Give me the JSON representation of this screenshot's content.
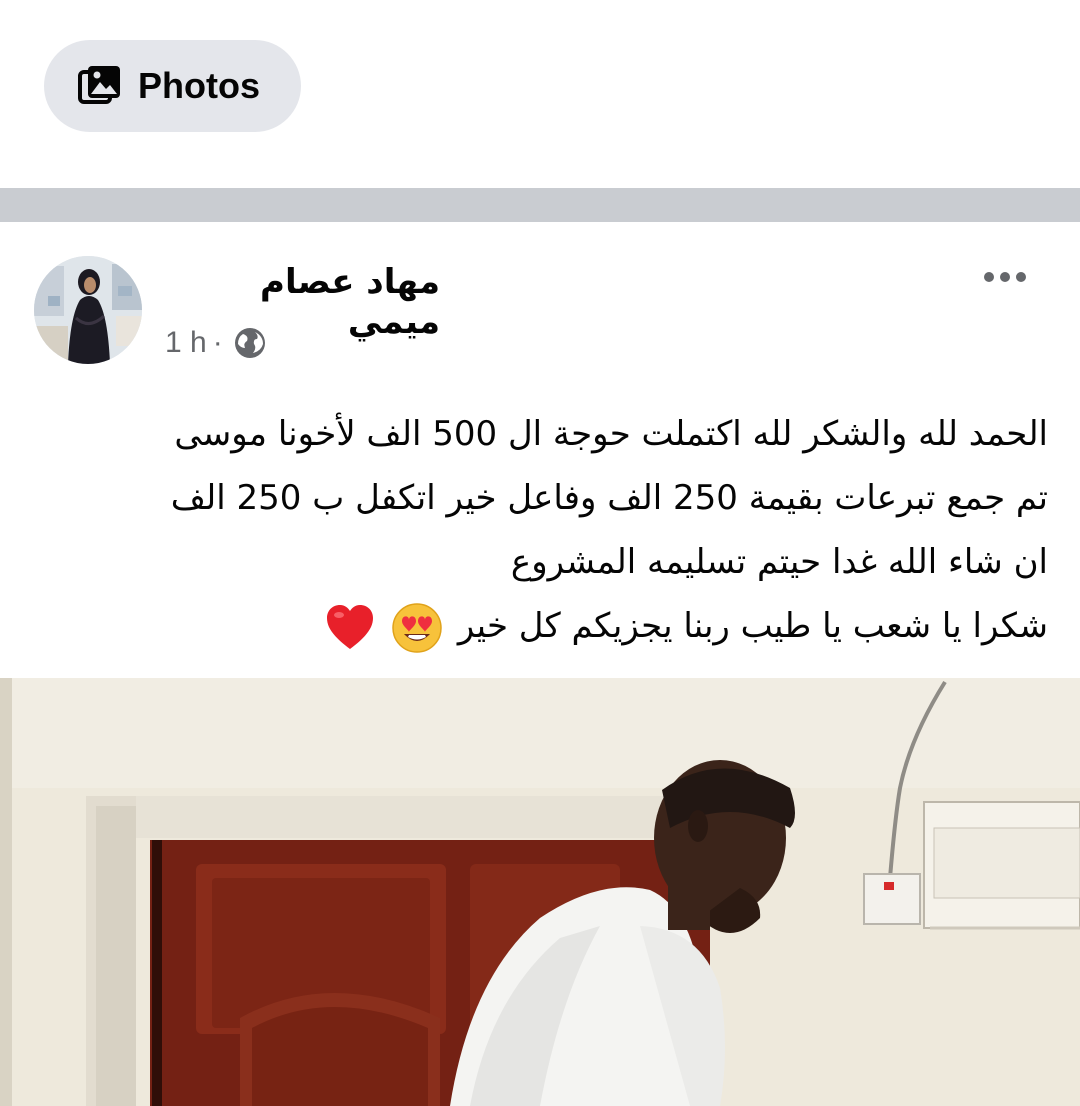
{
  "filter_chip": {
    "label": "Photos",
    "icon": "photo-album-icon"
  },
  "post": {
    "author_name": "مهاد عصام ميمي",
    "timestamp": "1 h",
    "separator": "·",
    "audience_icon": "globe-icon",
    "more_icon": "more-horizontal-icon",
    "text_lines": [
      "الحمد لله والشكر لله اكتملت حوجة ال 500 الف لأخونا موسى",
      "تم جمع تبرعات بقيمة 250 الف وفاعل خير اتكفل ب 250 الف",
      "ان شاء الله غدا حيتم تسليمه المشروع ",
      "شكرا يا شعب يا طيب ربنا يجزيكم كل خير"
    ],
    "emojis": [
      "heart-eyes-emoji",
      "red-heart-emoji"
    ]
  },
  "colors": {
    "chip_bg": "#e4e6eb",
    "separator": "#c9ccd1",
    "text_primary": "#050505",
    "text_secondary": "#65676b"
  }
}
